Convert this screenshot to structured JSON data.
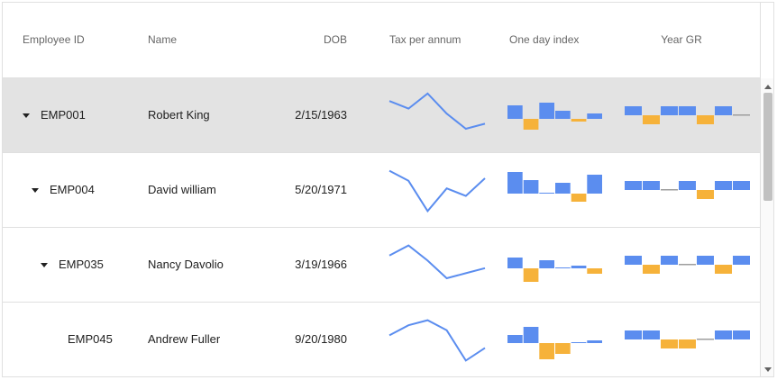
{
  "columns": {
    "id": "Employee ID",
    "name": "Name",
    "dob": "DOB",
    "tax": "Tax per annum",
    "index": "One day index",
    "yeargr": "Year GR"
  },
  "colors": {
    "line": "#5b8def",
    "positive": "#5b8def",
    "negative": "#f6b23a",
    "neutral": "#9e9e9e",
    "selected_row": "#e3e3e3"
  },
  "rows": [
    {
      "id": "EMP001",
      "name": "Robert King",
      "dob": "2/15/1963",
      "level": 0,
      "expanded": true,
      "selected": true,
      "tax": [
        6,
        3,
        9,
        1,
        -5,
        -3
      ],
      "index": [
        5,
        -4,
        6,
        3,
        -1,
        2
      ],
      "yeargr": [
        1,
        -1,
        1,
        1,
        -1,
        1,
        0
      ]
    },
    {
      "id": "EMP004",
      "name": "David william",
      "dob": "5/20/1971",
      "level": 1,
      "expanded": true,
      "selected": false,
      "tax": [
        8,
        4,
        -8,
        1,
        -2,
        5
      ],
      "index": [
        8,
        5,
        0,
        4,
        -3,
        7
      ],
      "yeargr": [
        1,
        1,
        0,
        1,
        -1,
        1,
        1
      ]
    },
    {
      "id": "EMP035",
      "name": "Nancy Davolio",
      "dob": "3/19/1966",
      "level": 2,
      "expanded": true,
      "selected": false,
      "tax": [
        4,
        8,
        2,
        -5,
        -3,
        -1
      ],
      "index": [
        4,
        -5,
        3,
        0,
        1,
        -2
      ],
      "yeargr": [
        1,
        -1,
        1,
        0,
        1,
        -1,
        1
      ]
    },
    {
      "id": "EMP045",
      "name": "Andrew Fuller",
      "dob": "9/20/1980",
      "level": 3,
      "expanded": false,
      "selected": false,
      "tax": [
        2,
        6,
        8,
        4,
        -8,
        -3
      ],
      "index": [
        3,
        6,
        -6,
        -4,
        0,
        1
      ],
      "yeargr": [
        1,
        1,
        -1,
        -1,
        0,
        1,
        1
      ]
    }
  ]
}
